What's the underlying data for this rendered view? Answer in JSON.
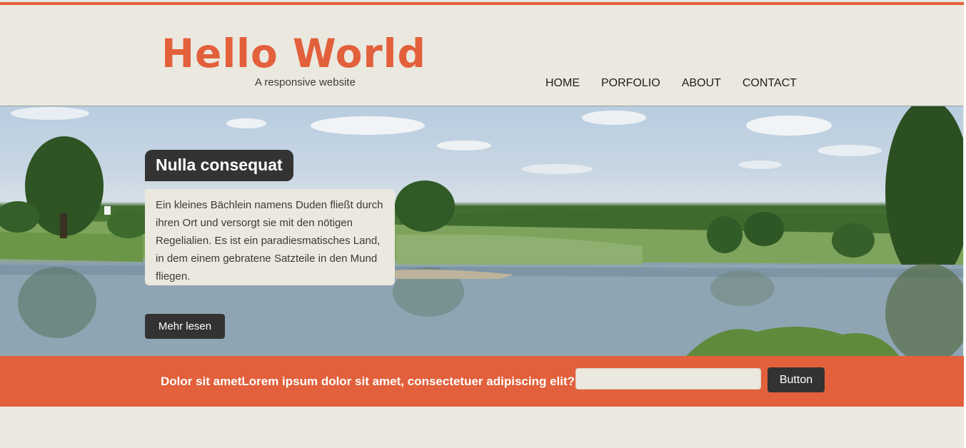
{
  "header": {
    "logo": "Hello World",
    "tagline": "A responsive website"
  },
  "nav": {
    "items": [
      {
        "label": "HOME"
      },
      {
        "label": "PORFOLIO"
      },
      {
        "label": "ABOUT"
      },
      {
        "label": "CONTACT"
      }
    ]
  },
  "hero": {
    "title": "Nulla consequat",
    "text": "Ein kleines Bächlein namens Duden fließt durch ihren Ort und versorgt sie mit den nötigen Regelialien. Es ist ein paradiesmatisches Land, in dem einem gebratene Satzteile in den Mund fliegen.",
    "button_label": "Mehr lesen"
  },
  "cta": {
    "text": "Dolor sit ametLorem ipsum dolor sit amet, consectetuer adipiscing elit?",
    "input_value": "",
    "button_label": "Button"
  },
  "colors": {
    "accent": "#e2603b",
    "background": "#ebe8df",
    "dark": "#333333"
  }
}
